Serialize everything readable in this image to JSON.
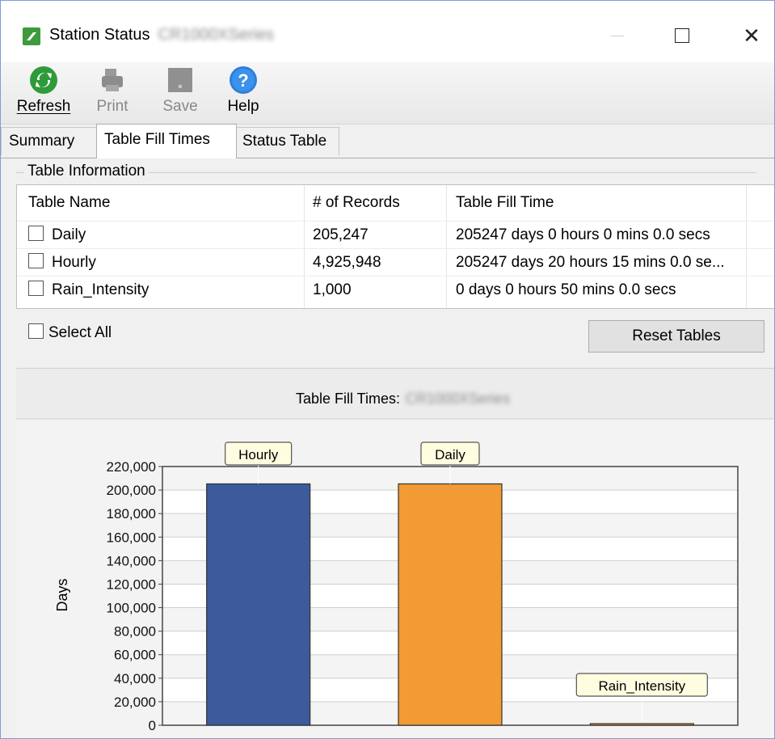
{
  "window": {
    "title": "Station Status",
    "title_suffix_blurred": "CR1000XSeries",
    "min_glyph": "—",
    "max_glyph": "☐",
    "close_glyph": "✕"
  },
  "toolbar": {
    "refresh_label": "Refresh",
    "print_label": "Print",
    "save_label": "Save",
    "help_label": "Help"
  },
  "tabs": [
    {
      "label": "Summary",
      "active": false
    },
    {
      "label": "Table Fill Times",
      "active": true
    },
    {
      "label": "Status Table",
      "active": false
    }
  ],
  "table_info": {
    "group_label": "Table Information",
    "headers": [
      "Table Name",
      "# of Records",
      "Table Fill Time"
    ],
    "rows": [
      {
        "name": "Daily",
        "records": "205,247",
        "fill_time": "205247 days 0 hours 0 mins 0.0 secs",
        "checked": false
      },
      {
        "name": "Hourly",
        "records": "4,925,948",
        "fill_time": "205247 days 20 hours 15 mins 0.0 se...",
        "checked": false
      },
      {
        "name": "Rain_Intensity",
        "records": "1,000",
        "fill_time": "0 days 0 hours 50 mins 0.0 secs",
        "checked": false
      }
    ],
    "select_all_label": "Select All",
    "reset_label": "Reset Tables"
  },
  "chart_data": {
    "type": "bar",
    "title": "Table Fill Times:",
    "title_suffix_blurred": "CR1000XSeries",
    "ylabel": "Days",
    "xlabel": "",
    "categories": [
      "Hourly",
      "Daily",
      "Rain_Intensity"
    ],
    "values": [
      205247,
      205247,
      0.035
    ],
    "colors": [
      "#3d5b9a",
      "#f29a33",
      "#f29a33"
    ],
    "ylim": [
      0,
      220000
    ],
    "yticks": [
      0,
      20000,
      40000,
      60000,
      80000,
      100000,
      120000,
      140000,
      160000,
      180000,
      200000,
      220000
    ],
    "ytick_labels": [
      "0",
      "20,000",
      "40,000",
      "60,000",
      "80,000",
      "100,000",
      "120,000",
      "140,000",
      "160,000",
      "180,000",
      "200,000",
      "220,000"
    ],
    "grid": true,
    "legend": "none"
  }
}
